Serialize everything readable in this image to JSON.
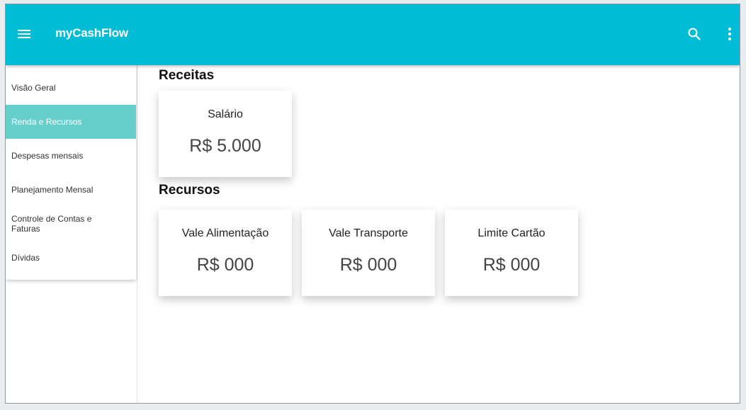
{
  "appbar": {
    "title": "myCashFlow",
    "menu_icon": "menu-icon",
    "search_icon": "search-icon",
    "more_icon": "more-vert-icon",
    "color": "#00bcd4"
  },
  "sidebar": {
    "active_color": "#66cfcc",
    "items": [
      {
        "label": "Visão Geral"
      },
      {
        "label": "Renda e Recursos"
      },
      {
        "label": "Despesas mensais"
      },
      {
        "label": "Planejamento Mensal"
      },
      {
        "label": "Controle de Contas e Faturas"
      },
      {
        "label": "Dívidas"
      }
    ]
  },
  "receitas": {
    "title": "Receitas",
    "cards": [
      {
        "label": "Salário",
        "value": "R$ 5.000"
      }
    ]
  },
  "recursos": {
    "title": "Recursos",
    "cards": [
      {
        "label": "Vale Alimentação",
        "value": "R$ 000"
      },
      {
        "label": "Vale Transporte",
        "value": "R$ 000"
      },
      {
        "label": "Limite Cartão",
        "value": "R$ 000"
      }
    ]
  }
}
